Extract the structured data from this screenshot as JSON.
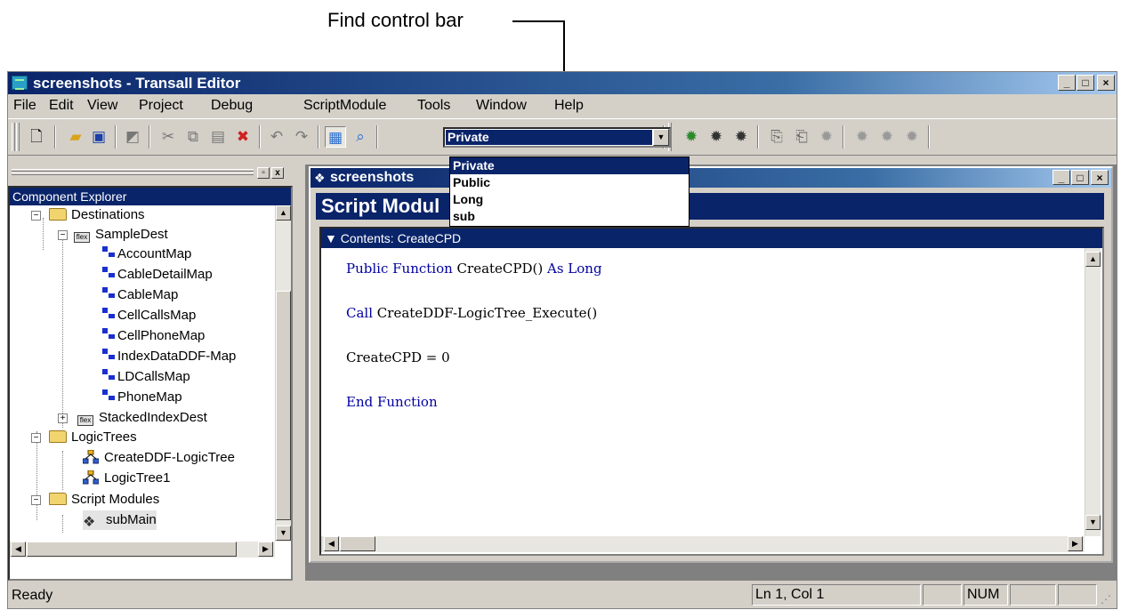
{
  "callout": {
    "label": "Find control bar"
  },
  "window": {
    "title": "screenshots - Transall Editor",
    "minimize": "_",
    "maximize": "□",
    "close": "×"
  },
  "menu": [
    "File",
    "Edit",
    "View",
    "Project",
    "Debug",
    "ScriptModule",
    "Tools",
    "Window",
    "Help"
  ],
  "find_control": {
    "value": "Private",
    "options": [
      "Private",
      "Public",
      "Long",
      "sub"
    ],
    "selected": "Private"
  },
  "explorer": {
    "title": "Component Explorer",
    "nodes": {
      "destinations": "Destinations",
      "sample_dest": "SampleDest",
      "maps": [
        "AccountMap",
        "CableDetailMap",
        "CableMap",
        "CellCallsMap",
        "CellPhoneMap",
        "IndexDataDDF-Map",
        "LDCallsMap",
        "PhoneMap"
      ],
      "stacked": "StackedIndexDest",
      "logic_trees": "LogicTrees",
      "logic_tree_items": [
        "CreateDDF-LogicTree",
        "LogicTree1"
      ],
      "script_modules": "Script Modules",
      "sub_main": "subMain"
    }
  },
  "editor": {
    "window_title": "screenshots",
    "header": "Script Modul",
    "contents_label": "Contents: CreateCPD",
    "code": [
      {
        "parts": [
          [
            "kw",
            "Public Function "
          ],
          [
            "t",
            "CreateCPD() "
          ],
          [
            "kw",
            "As Long"
          ]
        ]
      },
      {
        "parts": [
          [
            "kw",
            "Call "
          ],
          [
            "t",
            "CreateDDF-LogicTree_Execute()"
          ]
        ]
      },
      {
        "parts": [
          [
            "t",
            "CreateCPD = 0"
          ]
        ]
      },
      {
        "parts": [
          [
            "kw",
            "End Function"
          ]
        ]
      }
    ]
  },
  "status": {
    "text": "Ready",
    "position": "Ln 1, Col 1",
    "num": "NUM"
  },
  "colors": {
    "title_active": "#0a246a",
    "keyword": "#0000a0",
    "face": "#d4d0c8"
  }
}
